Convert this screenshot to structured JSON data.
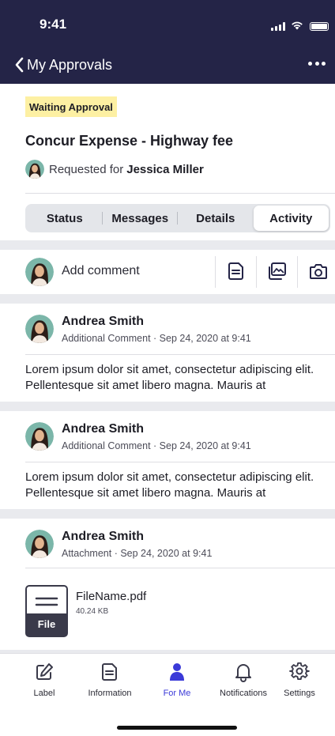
{
  "status_bar": {
    "time": "9:41"
  },
  "nav": {
    "back_label": "My Approvals"
  },
  "header": {
    "badge": "Waiting Approval",
    "title": "Concur Expense - Highway fee",
    "requested_prefix": "Requested for",
    "requested_name": "Jessica Miller"
  },
  "segments": [
    {
      "label": "Status"
    },
    {
      "label": "Messages"
    },
    {
      "label": "Details"
    },
    {
      "label": "Activity",
      "active": true
    }
  ],
  "comment": {
    "placeholder": "Add comment"
  },
  "activities": [
    {
      "name": "Andrea Smith",
      "meta": "Additional Comment · Sep 24, 2020 at 9:41",
      "body": "Lorem ipsum dolor sit amet, consectetur adipiscing elit. Pellentesque sit amet libero magna. Mauris at"
    },
    {
      "name": "Andrea Smith",
      "meta": "Additional Comment · Sep 24, 2020 at 9:41",
      "body": "Lorem ipsum dolor sit amet, consectetur adipiscing elit. Pellentesque sit amet libero magna. Mauris at"
    },
    {
      "name": "Andrea Smith",
      "meta": "Attachment · Sep 24, 2020 at 9:41",
      "file": {
        "name": "FileName.pdf",
        "size": "40.24 KB",
        "icon_label": "File"
      }
    }
  ],
  "tabbar": {
    "items": [
      {
        "label": "Label",
        "icon": "edit-icon"
      },
      {
        "label": "Information",
        "icon": "document-icon"
      },
      {
        "label": "For Me",
        "icon": "person-icon",
        "active": true
      },
      {
        "label": "Notifications",
        "icon": "bell-icon"
      },
      {
        "label": "Settings",
        "icon": "gear-icon"
      }
    ]
  },
  "colors": {
    "nav_bg": "#242447",
    "badge_bg": "#fdf0a3",
    "accent": "#3b3ad8",
    "page_bg": "#e9eaee"
  }
}
